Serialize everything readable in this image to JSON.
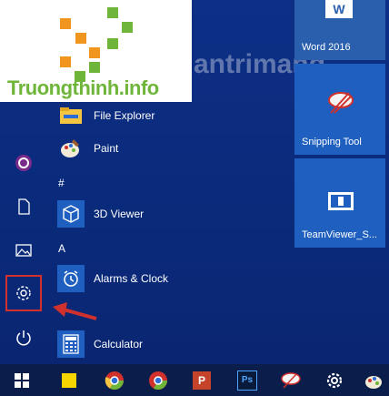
{
  "logo": {
    "text": "Truongthinh.info"
  },
  "watermark": {
    "text": "antrimang"
  },
  "rail": {
    "icons": [
      "user-icon",
      "document-icon",
      "pictures-icon",
      "settings-icon",
      "power-icon"
    ]
  },
  "apps": [
    {
      "label": "File Explorer",
      "icon": "folder-icon"
    },
    {
      "label": "Paint",
      "icon": "paint-icon"
    },
    {
      "label": "3D Viewer",
      "icon": "cube-icon"
    },
    {
      "label": "Alarms & Clock",
      "icon": "clock-icon"
    },
    {
      "label": "Calculator",
      "icon": "calculator-icon"
    }
  ],
  "section_headers": {
    "hash": "#",
    "a": "A"
  },
  "tiles": [
    {
      "label": "Word 2016",
      "icon": "word-icon"
    },
    {
      "label": "Snipping Tool",
      "icon": "scissors-icon"
    },
    {
      "label": "TeamViewer_S...",
      "icon": "teamviewer-icon"
    }
  ],
  "taskbar": {
    "items": [
      "windows-start-icon",
      "sticky-notes-icon",
      "chrome-icon",
      "chrome-alt-icon",
      "powerpoint-icon",
      "photoshop-icon",
      "snipping-tool-icon",
      "settings-icon",
      "paint-icon"
    ]
  },
  "colors": {
    "accent": "#1f5fbf",
    "highlight_red": "#d0312d",
    "start_bg": "#0d2f86"
  }
}
